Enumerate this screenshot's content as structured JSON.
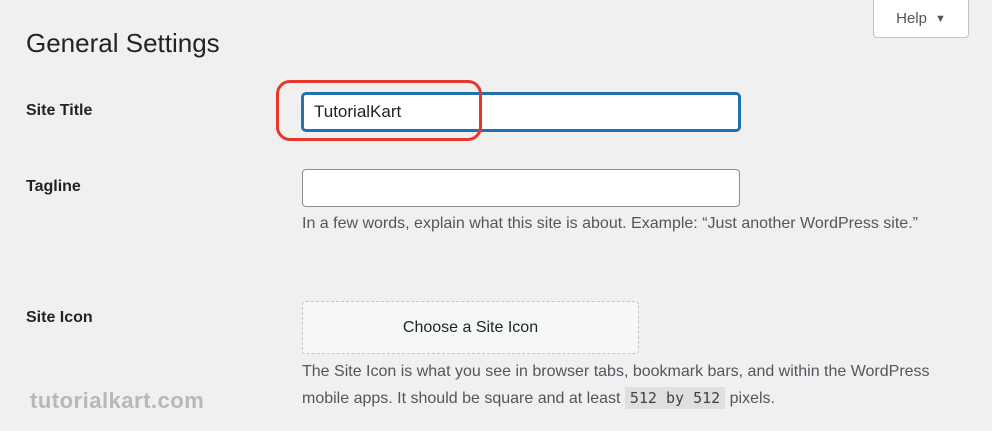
{
  "help": {
    "label": "Help",
    "caret": "▼"
  },
  "page": {
    "title": "General Settings"
  },
  "site_title": {
    "label": "Site Title",
    "value": "TutorialKart"
  },
  "tagline": {
    "label": "Tagline",
    "value": "",
    "description": "In a few words, explain what this site is about. Example: “Just another WordPress site.”"
  },
  "site_icon": {
    "label": "Site Icon",
    "button_label": "Choose a Site Icon",
    "description_before": "The Site Icon is what you see in browser tabs, bookmark bars, and within the WordPress mobile apps. It should be square and at least ",
    "size": "512 by 512",
    "description_after": " pixels."
  },
  "watermark": {
    "text": "tutorialkart.com"
  },
  "colors": {
    "focus_border": "#2271b1",
    "highlight": "#e8362a",
    "background": "#f0f0f1"
  }
}
